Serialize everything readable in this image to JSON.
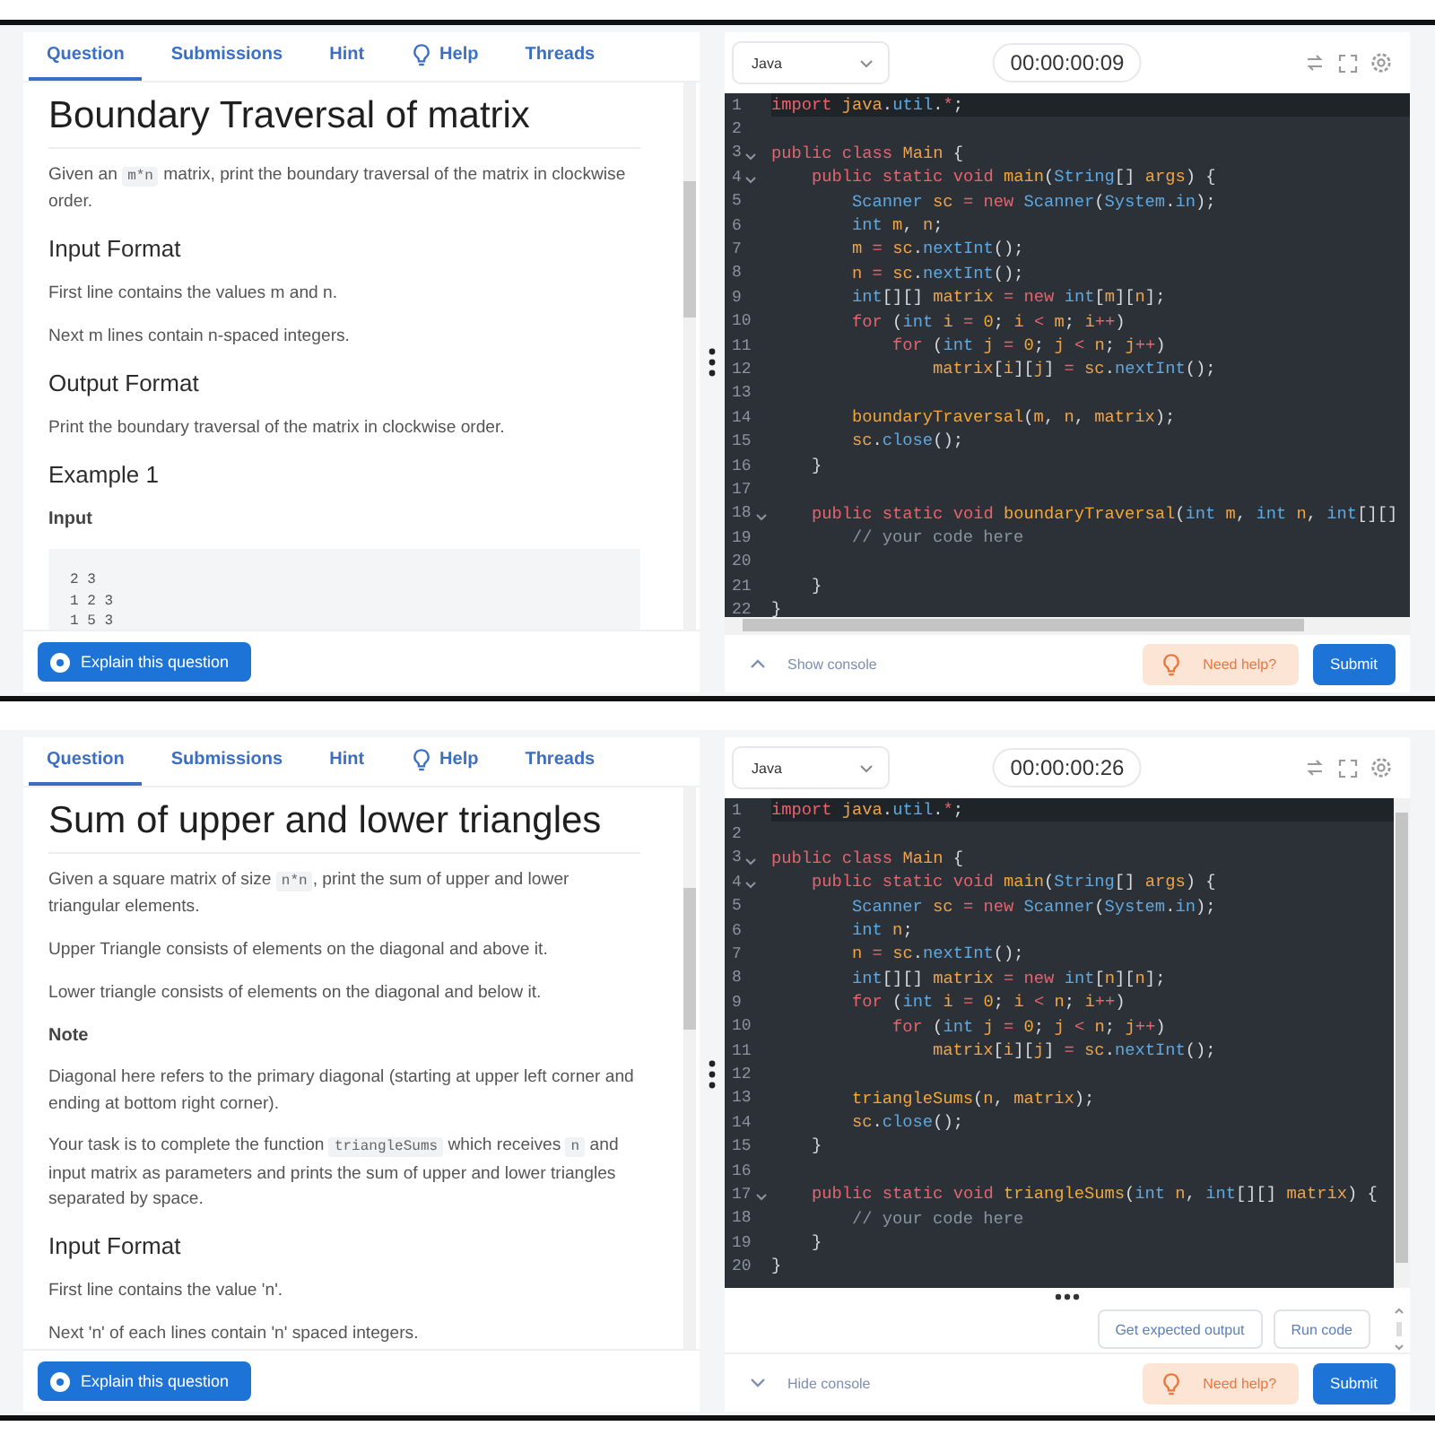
{
  "screens": [
    {
      "tabs": [
        {
          "label": "Question",
          "selected": true
        },
        {
          "label": "Submissions",
          "selected": false
        },
        {
          "label": "Hint",
          "selected": false
        },
        {
          "label": "Help",
          "selected": false
        },
        {
          "label": "Threads",
          "selected": false
        }
      ],
      "title": "Boundary Traversal of matrix",
      "content": [
        {
          "kind": "paragraph",
          "segments": [
            {
              "kind": "text",
              "text": "Given an "
            },
            {
              "kind": "code",
              "text": "m*n"
            },
            {
              "kind": "text",
              "text": " matrix, print the boundary traversal of the matrix in clockwise order."
            }
          ]
        },
        {
          "kind": "heading",
          "text": "Input Format"
        },
        {
          "kind": "paragraph",
          "segments": [
            {
              "kind": "text",
              "text": "First line contains the values m and n."
            }
          ]
        },
        {
          "kind": "paragraph",
          "segments": [
            {
              "kind": "text",
              "text": "Next m lines contain n-spaced integers."
            }
          ]
        },
        {
          "kind": "heading",
          "text": "Output Format"
        },
        {
          "kind": "paragraph",
          "segments": [
            {
              "kind": "text",
              "text": "Print the boundary traversal of the matrix in clockwise order."
            }
          ]
        },
        {
          "kind": "heading",
          "text": "Example 1"
        },
        {
          "kind": "label",
          "text": "Input"
        },
        {
          "kind": "code_block",
          "lines": [
            "2 3",
            "1 2 3",
            "1 5 3"
          ]
        }
      ],
      "explain_button": "Explain this question",
      "editor": {
        "language": "Java",
        "timer": "00:00:00:09",
        "lines": [
          {
            "number": "1",
            "code": "import java.util.*;",
            "active": true,
            "foldable": false
          },
          {
            "number": "2",
            "active": false,
            "foldable": false
          },
          {
            "number": "3",
            "code": "public class Main {",
            "active": false,
            "foldable": true
          },
          {
            "number": "4",
            "code": "    public static void main(String[] args) {",
            "active": false,
            "foldable": true
          },
          {
            "number": "5",
            "code": "        Scanner sc = new Scanner(System.in);",
            "active": false,
            "foldable": false
          },
          {
            "number": "6",
            "code": "        int m, n;",
            "active": false,
            "foldable": false
          },
          {
            "number": "7",
            "code": "        m = sc.nextInt();",
            "active": false,
            "foldable": false
          },
          {
            "number": "8",
            "code": "        n = sc.nextInt();",
            "active": false,
            "foldable": false
          },
          {
            "number": "9",
            "code": "        int[][] matrix = new int[m][n];",
            "active": false,
            "foldable": false
          },
          {
            "number": "10",
            "code": "        for (int i = 0; i < m; i++)",
            "active": false,
            "foldable": false
          },
          {
            "number": "11",
            "code": "            for (int j = 0; j < n; j++)",
            "active": false,
            "foldable": false
          },
          {
            "number": "12",
            "code": "                matrix[i][j] = sc.nextInt();",
            "active": false,
            "foldable": false
          },
          {
            "number": "13",
            "active": false,
            "foldable": false
          },
          {
            "number": "14",
            "code": "        boundaryTraversal(m, n, matrix);",
            "active": false,
            "foldable": false
          },
          {
            "number": "15",
            "code": "        sc.close();",
            "active": false,
            "foldable": false
          },
          {
            "number": "16",
            "code": "    }",
            "active": false,
            "foldable": false
          },
          {
            "number": "17",
            "active": false,
            "foldable": false
          },
          {
            "number": "18",
            "code": "    public static void boundaryTraversal(int m, int n, int[][]",
            "active": false,
            "foldable": true
          },
          {
            "number": "19",
            "code": "        // your code here",
            "active": false,
            "foldable": false
          },
          {
            "number": "20",
            "active": false,
            "foldable": false
          },
          {
            "number": "21",
            "code": "    }",
            "active": false,
            "foldable": false
          },
          {
            "number": "22",
            "code": "}",
            "active": false,
            "foldable": false
          }
        ],
        "console": {
          "label": "Show console",
          "expanded": false
        },
        "need_help": "Need help?",
        "submit": "Submit"
      }
    },
    {
      "tabs": [
        {
          "label": "Question",
          "selected": true
        },
        {
          "label": "Submissions",
          "selected": false
        },
        {
          "label": "Hint",
          "selected": false
        },
        {
          "label": "Help",
          "selected": false
        },
        {
          "label": "Threads",
          "selected": false
        }
      ],
      "title": "Sum of upper and lower triangles",
      "content": [
        {
          "kind": "paragraph",
          "segments": [
            {
              "kind": "text",
              "text": "Given a square matrix of size "
            },
            {
              "kind": "code",
              "text": "n*n"
            },
            {
              "kind": "text",
              "text": ", print the sum of upper and lower triangular elements."
            }
          ]
        },
        {
          "kind": "paragraph",
          "segments": [
            {
              "kind": "text",
              "text": "Upper Triangle consists of elements on the diagonal and above it."
            }
          ]
        },
        {
          "kind": "paragraph",
          "segments": [
            {
              "kind": "text",
              "text": "Lower triangle consists of elements on the diagonal and below it."
            }
          ]
        },
        {
          "kind": "label",
          "text": "Note"
        },
        {
          "kind": "paragraph",
          "segments": [
            {
              "kind": "text",
              "text": "Diagonal here refers to the primary diagonal (starting at upper left corner and ending at bottom right corner)."
            }
          ]
        },
        {
          "kind": "paragraph",
          "segments": [
            {
              "kind": "text",
              "text": "Your task is to complete the function "
            },
            {
              "kind": "code",
              "text": "triangleSums"
            },
            {
              "kind": "text",
              "text": " which receives "
            },
            {
              "kind": "code",
              "text": "n"
            },
            {
              "kind": "text",
              "text": " and input matrix as parameters and prints the sum of upper and lower triangles separated by space."
            }
          ]
        },
        {
          "kind": "heading",
          "text": "Input Format"
        },
        {
          "kind": "paragraph",
          "segments": [
            {
              "kind": "text",
              "text": "First line contains the value 'n'."
            }
          ]
        },
        {
          "kind": "paragraph",
          "segments": [
            {
              "kind": "text",
              "text": "Next 'n' of each lines contain 'n' spaced integers."
            }
          ]
        }
      ],
      "explain_button": "Explain this question",
      "editor": {
        "language": "Java",
        "timer": "00:00:00:26",
        "lines": [
          {
            "number": "1",
            "code": "import java.util.*;",
            "active": true,
            "foldable": false
          },
          {
            "number": "2",
            "active": false,
            "foldable": false
          },
          {
            "number": "3",
            "code": "public class Main {",
            "active": false,
            "foldable": true
          },
          {
            "number": "4",
            "code": "    public static void main(String[] args) {",
            "active": false,
            "foldable": true
          },
          {
            "number": "5",
            "code": "        Scanner sc = new Scanner(System.in);",
            "active": false,
            "foldable": false
          },
          {
            "number": "6",
            "code": "        int n;",
            "active": false,
            "foldable": false
          },
          {
            "number": "7",
            "code": "        n = sc.nextInt();",
            "active": false,
            "foldable": false
          },
          {
            "number": "8",
            "code": "        int[][] matrix = new int[n][n];",
            "active": false,
            "foldable": false
          },
          {
            "number": "9",
            "code": "        for (int i = 0; i < n; i++)",
            "active": false,
            "foldable": false
          },
          {
            "number": "10",
            "code": "            for (int j = 0; j < n; j++)",
            "active": false,
            "foldable": false
          },
          {
            "number": "11",
            "code": "                matrix[i][j] = sc.nextInt();",
            "active": false,
            "foldable": false
          },
          {
            "number": "12",
            "active": false,
            "foldable": false
          },
          {
            "number": "13",
            "code": "        triangleSums(n, matrix);",
            "active": false,
            "foldable": false
          },
          {
            "number": "14",
            "code": "        sc.close();",
            "active": false,
            "foldable": false
          },
          {
            "number": "15",
            "code": "    }",
            "active": false,
            "foldable": false
          },
          {
            "number": "16",
            "active": false,
            "foldable": false
          },
          {
            "number": "17",
            "code": "    public static void triangleSums(int n, int[][] matrix) {",
            "active": false,
            "foldable": true
          },
          {
            "number": "18",
            "code": "        // your code here",
            "active": false,
            "foldable": false
          },
          {
            "number": "19",
            "code": "    }",
            "active": false,
            "foldable": false
          },
          {
            "number": "20",
            "code": "}",
            "active": false,
            "foldable": false
          }
        ],
        "console": {
          "label": "Hide console",
          "expanded": true,
          "buttons": [
            "Get expected output",
            "Run code"
          ]
        },
        "need_help": "Need help?",
        "submit": "Submit"
      }
    }
  ]
}
